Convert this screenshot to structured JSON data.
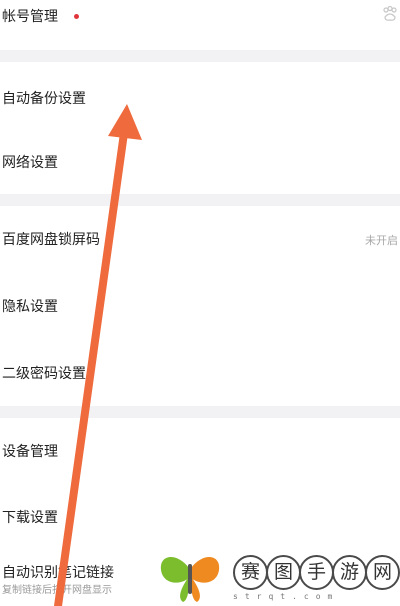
{
  "settings": {
    "account_management": {
      "label": "帐号管理"
    },
    "auto_backup": {
      "label": "自动备份设置"
    },
    "network": {
      "label": "网络设置"
    },
    "screen_lock": {
      "label": "百度网盘锁屏码",
      "value": "未开启"
    },
    "privacy": {
      "label": "隐私设置"
    },
    "second_password": {
      "label": "二级密码设置"
    },
    "device_management": {
      "label": "设备管理"
    },
    "download": {
      "label": "下载设置"
    },
    "auto_recognize_links": {
      "label": "自动识别笔记链接",
      "subtitle": "复制链接后打开网盘显示"
    }
  },
  "icons": {
    "skin": "skin-icon",
    "notification": "red-dot-icon",
    "annotation": "annotation-arrow",
    "watermark_logo": "butterfly-logo"
  },
  "watermark": {
    "chars": [
      "赛",
      "图",
      "手",
      "游",
      "网"
    ],
    "url": "strqt.com"
  },
  "colors": {
    "arrow": "#ef6a3d",
    "red_dot": "#e0353b",
    "divider": "#f2f2f4",
    "logo_green": "#7cbd2d",
    "logo_orange": "#ef8a21"
  }
}
